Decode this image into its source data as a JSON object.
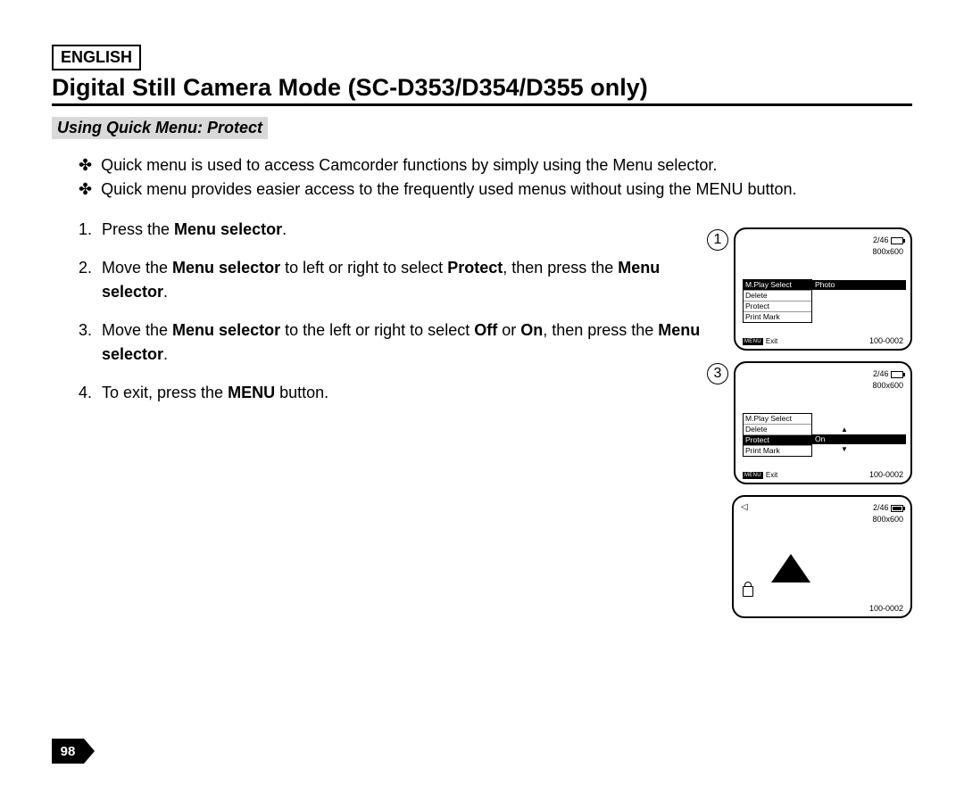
{
  "language": "ENGLISH",
  "title": "Digital Still Camera Mode (SC-D353/D354/D355 only)",
  "subheading": "Using Quick Menu: Protect",
  "bullets": [
    "Quick menu is used to access Camcorder functions by simply using the Menu selector.",
    "Quick menu provides easier access to the frequently used menus without using the MENU button."
  ],
  "steps": {
    "s1_pre": "Press the ",
    "s1_b1": "Menu selector",
    "s1_post": ".",
    "s2_pre": "Move the ",
    "s2_b1": "Menu selector",
    "s2_mid1": " to left or right to select ",
    "s2_b2": "Protect",
    "s2_mid2": ", then press the ",
    "s2_b3": "Menu selector",
    "s2_post": ".",
    "s3_pre": "Move the ",
    "s3_b1": "Menu selector",
    "s3_mid1": " to the left or right to select ",
    "s3_b2": "Off",
    "s3_mid2": " or ",
    "s3_b3": "On",
    "s3_mid3": ", then press the ",
    "s3_b4": "Menu selector",
    "s3_post": ".",
    "s4_pre": "To exit, press the ",
    "s4_b1": "MENU",
    "s4_post": " button."
  },
  "screen_labels": {
    "s1": "1",
    "s3": "3"
  },
  "screen": {
    "count": "2/46",
    "res": "800x600",
    "file": "100-0002",
    "exit": "Exit",
    "menu_tag": "MENU",
    "items": {
      "mplay": "M.Play Select",
      "delete": "Delete",
      "protect": "Protect",
      "print": "Print Mark"
    },
    "val_photo": "Photo",
    "val_on": "On"
  },
  "page_number": "98"
}
